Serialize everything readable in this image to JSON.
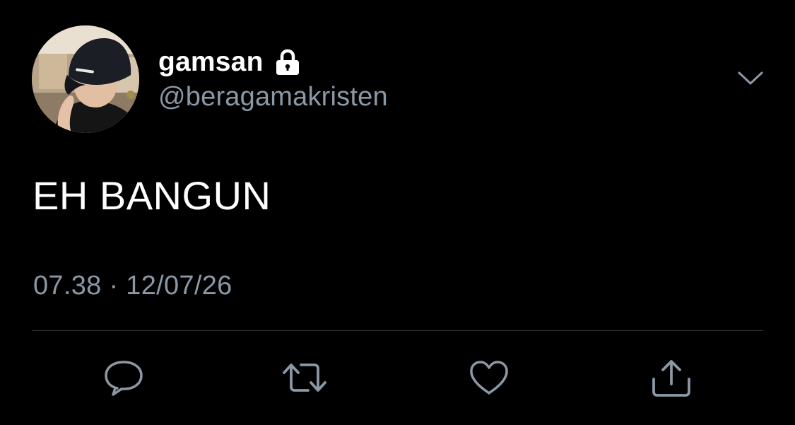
{
  "user": {
    "display_name": "gamsan",
    "handle": "@beragamakristen",
    "protected_icon": "lock-icon",
    "avatar": "profile-photo"
  },
  "tweet": {
    "text": "EH BANGUN",
    "timestamp": "07.38 · 12/07/26"
  },
  "menu_icon": "chevron-down-icon",
  "actions": [
    {
      "icon": "reply-icon"
    },
    {
      "icon": "retweet-icon"
    },
    {
      "icon": "like-icon"
    },
    {
      "icon": "share-icon"
    }
  ],
  "colors": {
    "background": "#000000",
    "primary_text": "#ffffff",
    "secondary_text": "#8b98a5",
    "divider": "#2f3336"
  }
}
